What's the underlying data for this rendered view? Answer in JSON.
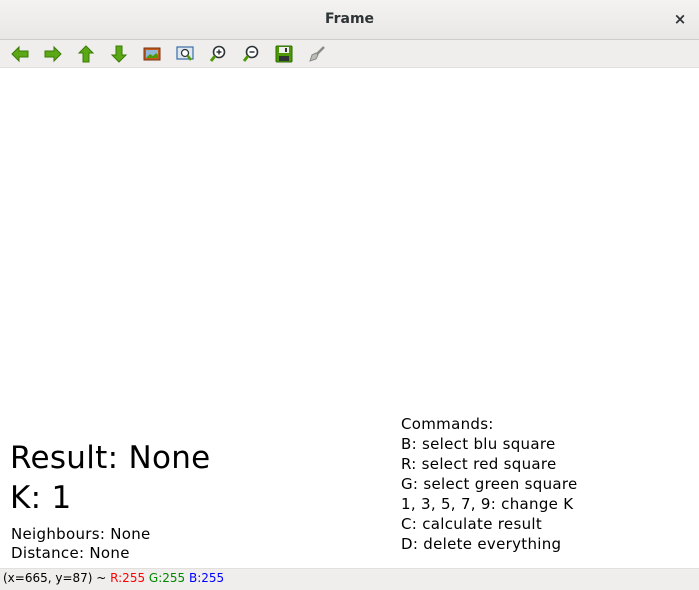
{
  "window": {
    "title": "Frame",
    "close_symbol": "×"
  },
  "toolbar": {
    "buttons": [
      {
        "name": "pan-left",
        "icon": "arrow-left-icon",
        "color": "#4e9a06"
      },
      {
        "name": "pan-right",
        "icon": "arrow-right-icon",
        "color": "#4e9a06"
      },
      {
        "name": "pan-up",
        "icon": "arrow-up-icon",
        "color": "#4e9a06"
      },
      {
        "name": "pan-down",
        "icon": "arrow-down-icon",
        "color": "#4e9a06"
      },
      {
        "name": "zoom-original",
        "icon": "image-icon",
        "color": "#c45a1c"
      },
      {
        "name": "zoom-fit",
        "icon": "zoom-fit-icon",
        "color": "#3a6ea5"
      },
      {
        "name": "zoom-in",
        "icon": "zoom-in-icon",
        "color": "#4e9a06"
      },
      {
        "name": "zoom-out",
        "icon": "zoom-out-icon",
        "color": "#4e9a06"
      },
      {
        "name": "save",
        "icon": "save-icon",
        "color": "#4e9a06"
      },
      {
        "name": "properties",
        "icon": "brush-icon",
        "color": "#888a85"
      }
    ]
  },
  "canvas": {
    "result": "Result: None",
    "k": "K: 1",
    "neighbours": "Neighbours: None",
    "distance": "Distance: None",
    "commands_title": "Commands:",
    "commands": [
      "B: select blu square",
      "R: select red square",
      "G: select green square",
      "1, 3, 5, 7, 9: change K",
      "C: calculate result",
      "D: delete everything"
    ]
  },
  "statusbar": {
    "position": "(x=665, y=87) ~ ",
    "r": "R:255",
    "g": "G:255",
    "b": "B:255",
    "colors": {
      "r": "#ff0000",
      "g": "#008800",
      "b": "#0000ff"
    }
  }
}
